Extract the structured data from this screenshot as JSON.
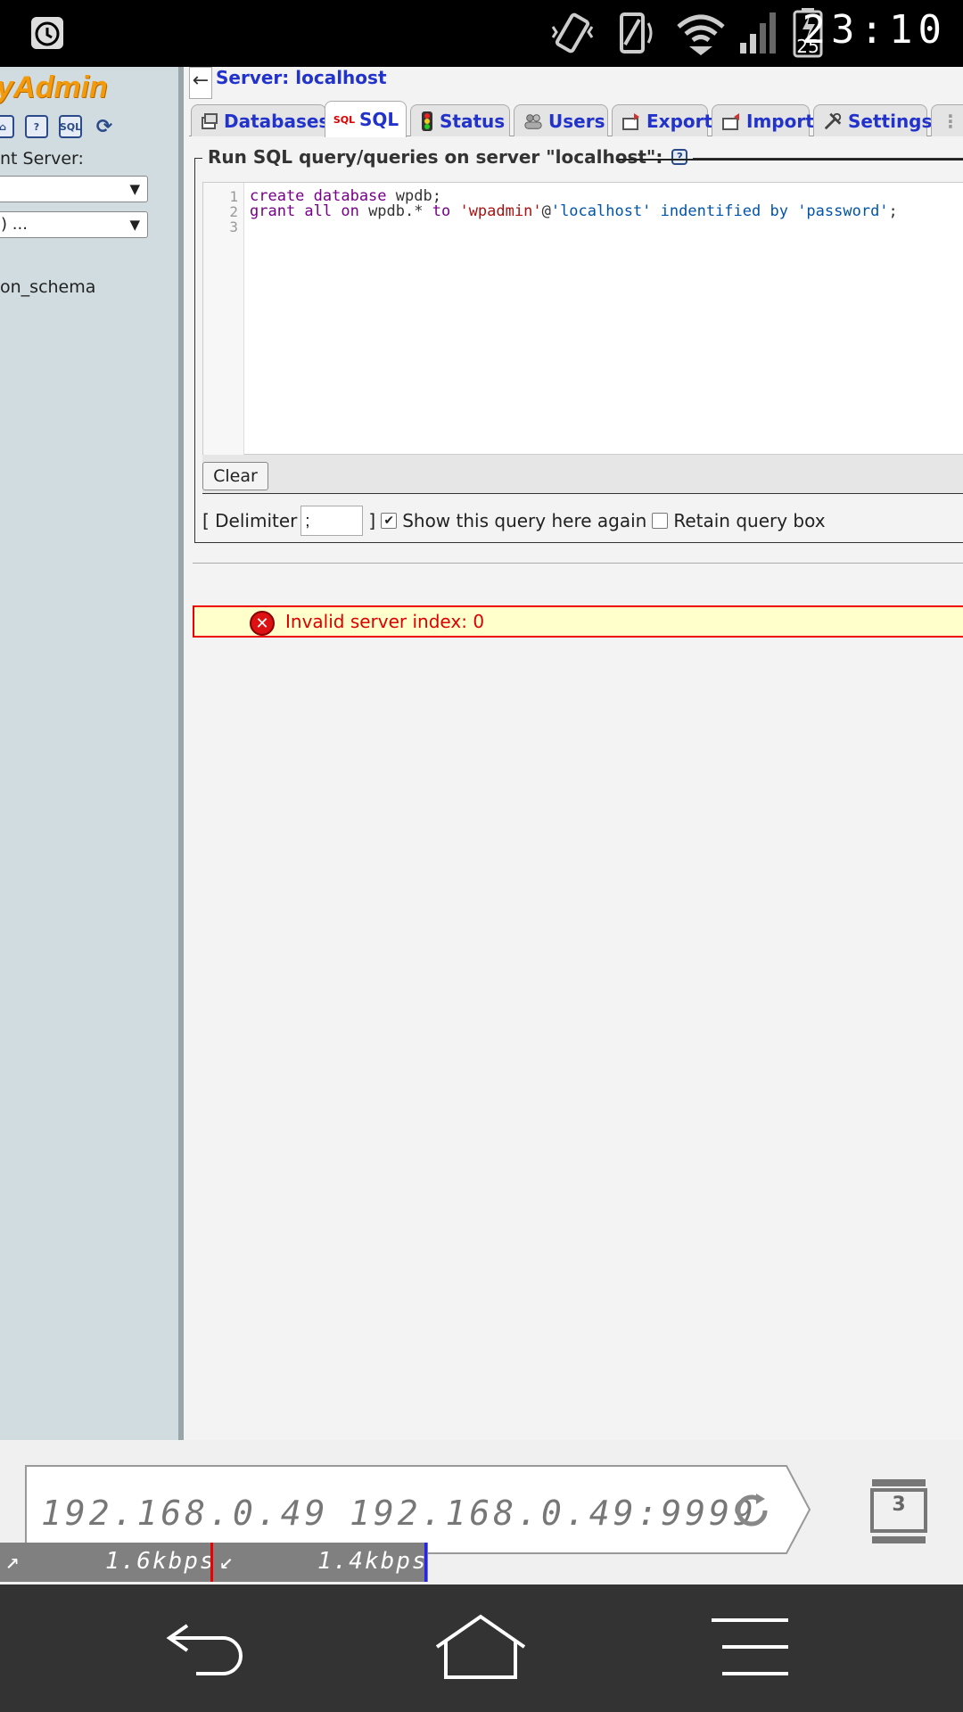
{
  "status_bar": {
    "time": "23:10",
    "battery": "25",
    "icons": [
      "alarm-icon",
      "vibrate-icon",
      "nfc-icon",
      "wifi-icon",
      "signal-icon",
      "battery-charging-icon"
    ]
  },
  "sidebar": {
    "logo": "yAdmin",
    "icons": [
      "home-icon",
      "help-icon",
      "sql-icon",
      "reload-icon"
    ],
    "server_label": "nt Server:",
    "select1_value": "",
    "select2_value": ") ...",
    "schema_item": "on_schema"
  },
  "main": {
    "server_crumb": "Server: localhost",
    "tabs": [
      {
        "label": "Databases",
        "icon": "database-icon"
      },
      {
        "label": "SQL",
        "icon": "sql-icon"
      },
      {
        "label": "Status",
        "icon": "traffic-light-icon"
      },
      {
        "label": "Users",
        "icon": "users-icon"
      },
      {
        "label": "Export",
        "icon": "export-icon"
      },
      {
        "label": "Import",
        "icon": "import-icon"
      },
      {
        "label": "Settings",
        "icon": "tools-icon"
      }
    ],
    "active_tab": "SQL",
    "legend": "Run SQL query/queries on server \"localhost\":",
    "editor": {
      "line_numbers": [
        "1",
        "2",
        "3"
      ],
      "line1": {
        "kw": "create database",
        "rest": " wpdb;"
      },
      "line2": {
        "kw1": "grant all on",
        "mid1": " wpdb.* ",
        "kw2": "to",
        "str1": "'wpadmin'",
        "at": "@",
        "str2": "'localhost'",
        "kw3": " indentified by ",
        "str3": "'password'",
        "end": ";"
      }
    },
    "clear_label": "Clear",
    "delimiter_label": "[ Delimiter",
    "delimiter_value": ";",
    "delimiter_close": "]",
    "show_query_label": "Show this query here again",
    "show_query_checked": true,
    "retain_label": "Retain query box",
    "retain_checked": false,
    "error_message": "Invalid server index: 0"
  },
  "browser": {
    "url_host": "192.168.0.49",
    "url_full": "192.168.0.49:9999",
    "tab_count": "3",
    "upload_speed": "1.6kbps",
    "download_speed": "1.4kbps"
  },
  "nav": {
    "buttons": [
      "back-icon",
      "home-icon",
      "menu-icon"
    ]
  },
  "colors": {
    "accent_link": "#2233cc",
    "error_red": "#dd0000",
    "error_bg": "#ffffcc",
    "sidebar_bg": "#d0dce0"
  }
}
